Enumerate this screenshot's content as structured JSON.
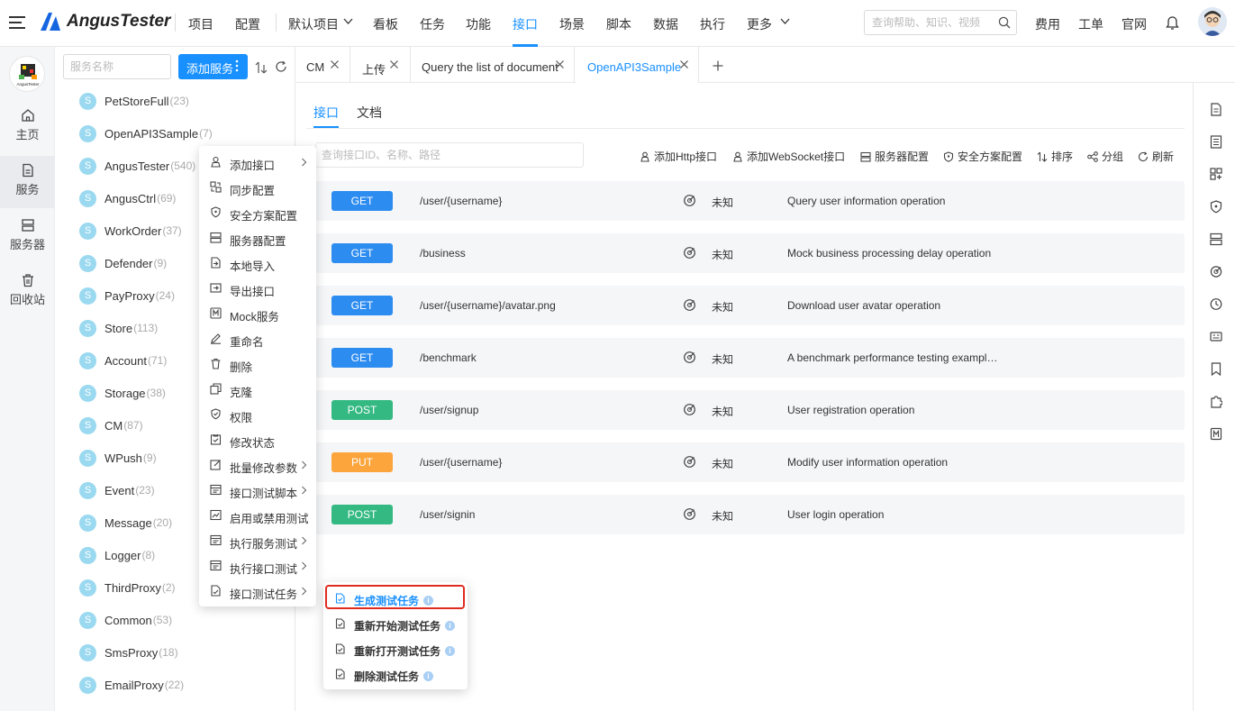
{
  "app": {
    "name": "AngusTester"
  },
  "nav": {
    "items": [
      {
        "label": "项目"
      },
      {
        "label": "配置"
      },
      {
        "label": "默认项目"
      },
      {
        "label": "看板"
      },
      {
        "label": "任务"
      },
      {
        "label": "功能"
      },
      {
        "label": "接口"
      },
      {
        "label": "场景"
      },
      {
        "label": "脚本"
      },
      {
        "label": "数据"
      },
      {
        "label": "执行"
      },
      {
        "label": "更多"
      }
    ],
    "active": "接口"
  },
  "header": {
    "search_placeholder": "查询帮助、知识、视频",
    "links": [
      "费用",
      "工单",
      "官网"
    ]
  },
  "left_rail": {
    "logo_text": "AngusTester",
    "items": [
      {
        "label": "主页",
        "icon": "home-icon"
      },
      {
        "label": "服务",
        "icon": "document-icon"
      },
      {
        "label": "服务器",
        "icon": "server-icon"
      },
      {
        "label": "回收站",
        "icon": "trash-icon"
      }
    ],
    "active": "服务"
  },
  "services": {
    "search_placeholder": "服务名称",
    "add_button": "添加服务",
    "items": [
      {
        "avatar": "S",
        "name": "PetStoreFull",
        "count": "(23)"
      },
      {
        "avatar": "S",
        "name": "OpenAPI3Sample",
        "count": "(7)"
      },
      {
        "avatar": "S",
        "name": "AngusTester",
        "count": "(540)"
      },
      {
        "avatar": "S",
        "name": "AngusCtrl",
        "count": "(69)"
      },
      {
        "avatar": "S",
        "name": "WorkOrder",
        "count": "(37)"
      },
      {
        "avatar": "S",
        "name": "Defender",
        "count": "(9)"
      },
      {
        "avatar": "S",
        "name": "PayProxy",
        "count": "(24)"
      },
      {
        "avatar": "S",
        "name": "Store",
        "count": "(113)"
      },
      {
        "avatar": "S",
        "name": "Account",
        "count": "(71)"
      },
      {
        "avatar": "S",
        "name": "Storage",
        "count": "(38)"
      },
      {
        "avatar": "S",
        "name": "CM",
        "count": "(87)"
      },
      {
        "avatar": "S",
        "name": "WPush",
        "count": "(9)"
      },
      {
        "avatar": "S",
        "name": "Event",
        "count": "(23)"
      },
      {
        "avatar": "S",
        "name": "Message",
        "count": "(20)"
      },
      {
        "avatar": "S",
        "name": "Logger",
        "count": "(8)"
      },
      {
        "avatar": "S",
        "name": "ThirdProxy",
        "count": "(2)"
      },
      {
        "avatar": "S",
        "name": "Common",
        "count": "(53)"
      },
      {
        "avatar": "S",
        "name": "SmsProxy",
        "count": "(18)"
      },
      {
        "avatar": "S",
        "name": "EmailProxy",
        "count": "(22)"
      }
    ]
  },
  "tabs": [
    {
      "label": "CM"
    },
    {
      "label": "上传"
    },
    {
      "label": "Query the list of document"
    },
    {
      "label": "OpenAPI3Sample"
    }
  ],
  "active_tab": "OpenAPI3Sample",
  "main": {
    "inner_tabs": [
      {
        "label": "接口"
      },
      {
        "label": "文档"
      }
    ],
    "search_placeholder": "查询接口ID、名称、路径",
    "toolbar": [
      {
        "label": "添加Http接口",
        "icon": "http-icon"
      },
      {
        "label": "添加WebSocket接口",
        "icon": "websocket-icon"
      },
      {
        "label": "服务器配置",
        "icon": "server-icon"
      },
      {
        "label": "安全方案配置",
        "icon": "shield-icon"
      },
      {
        "label": "排序",
        "icon": "sort-icon"
      },
      {
        "label": "分组",
        "icon": "group-icon"
      },
      {
        "label": "刷新",
        "icon": "refresh-icon"
      }
    ],
    "apis": [
      {
        "method": "GET",
        "color": "#2d8cf0",
        "path": "/user/{username}",
        "status": "未知",
        "desc": "Query user information operation"
      },
      {
        "method": "GET",
        "color": "#2d8cf0",
        "path": "/business",
        "status": "未知",
        "desc": "Mock business processing delay operation"
      },
      {
        "method": "GET",
        "color": "#2d8cf0",
        "path": "/user/{username}/avatar.png",
        "status": "未知",
        "desc": "Download user avatar operation"
      },
      {
        "method": "GET",
        "color": "#2d8cf0",
        "path": "/benchmark",
        "status": "未知",
        "desc": "A benchmark performance testing exampl…"
      },
      {
        "method": "POST",
        "color": "#34b982",
        "path": "/user/signup",
        "status": "未知",
        "desc": "User registration operation"
      },
      {
        "method": "PUT",
        "color": "#fba53c",
        "path": "/user/{username}",
        "status": "未知",
        "desc": "Modify user information operation"
      },
      {
        "method": "POST",
        "color": "#34b982",
        "path": "/user/signin",
        "status": "未知",
        "desc": "User login operation"
      }
    ]
  },
  "context_menu": {
    "items": [
      {
        "label": "添加接口",
        "submenu": true
      },
      {
        "label": "同步配置"
      },
      {
        "label": "安全方案配置"
      },
      {
        "label": "服务器配置"
      },
      {
        "label": "本地导入"
      },
      {
        "label": "导出接口"
      },
      {
        "label": "Mock服务"
      },
      {
        "label": "重命名"
      },
      {
        "label": "删除"
      },
      {
        "label": "克隆"
      },
      {
        "label": "权限"
      },
      {
        "label": "修改状态"
      },
      {
        "label": "批量修改参数",
        "submenu": true
      },
      {
        "label": "接口测试脚本",
        "submenu": true
      },
      {
        "label": "启用或禁用测试"
      },
      {
        "label": "执行服务测试",
        "submenu": true
      },
      {
        "label": "执行接口测试",
        "submenu": true
      },
      {
        "label": "接口测试任务",
        "submenu": true
      }
    ]
  },
  "sub_menu": {
    "items": [
      {
        "label": "生成测试任务",
        "highlighted": true
      },
      {
        "label": "重新开始测试任务"
      },
      {
        "label": "重新打开测试任务"
      },
      {
        "label": "删除测试任务"
      }
    ]
  },
  "colors": {
    "accent": "#1890ff",
    "highlight_border": "#e02b20"
  }
}
